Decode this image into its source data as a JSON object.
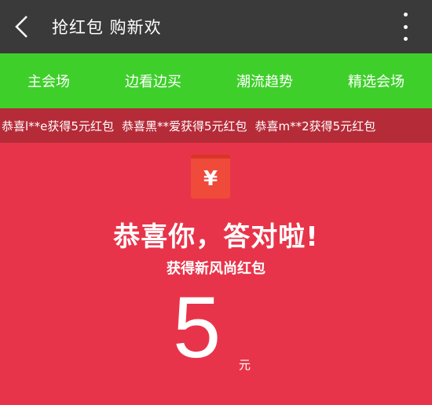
{
  "header": {
    "title": "抢红包 购新欢",
    "back_icon": "back-arrow-icon",
    "more_icon": "more-vertical-icon"
  },
  "tabs": [
    {
      "label": "主会场"
    },
    {
      "label": "边看边买"
    },
    {
      "label": "潮流趋势"
    },
    {
      "label": "精选会场"
    }
  ],
  "marquee": {
    "items": [
      "恭喜l**e获得5元红包",
      "恭喜黑**爱获得5元红包",
      "恭喜m**2获得5元红包"
    ]
  },
  "result": {
    "envelope_symbol": "¥",
    "congrats": "恭喜你，答对啦!",
    "subtitle": "获得新风尚红包",
    "amount": "5",
    "unit": "元"
  },
  "colors": {
    "topbar": "#3a3a3a",
    "tabs": "#3fcf2b",
    "marquee": "#b52b38",
    "main": "#e8344a"
  }
}
